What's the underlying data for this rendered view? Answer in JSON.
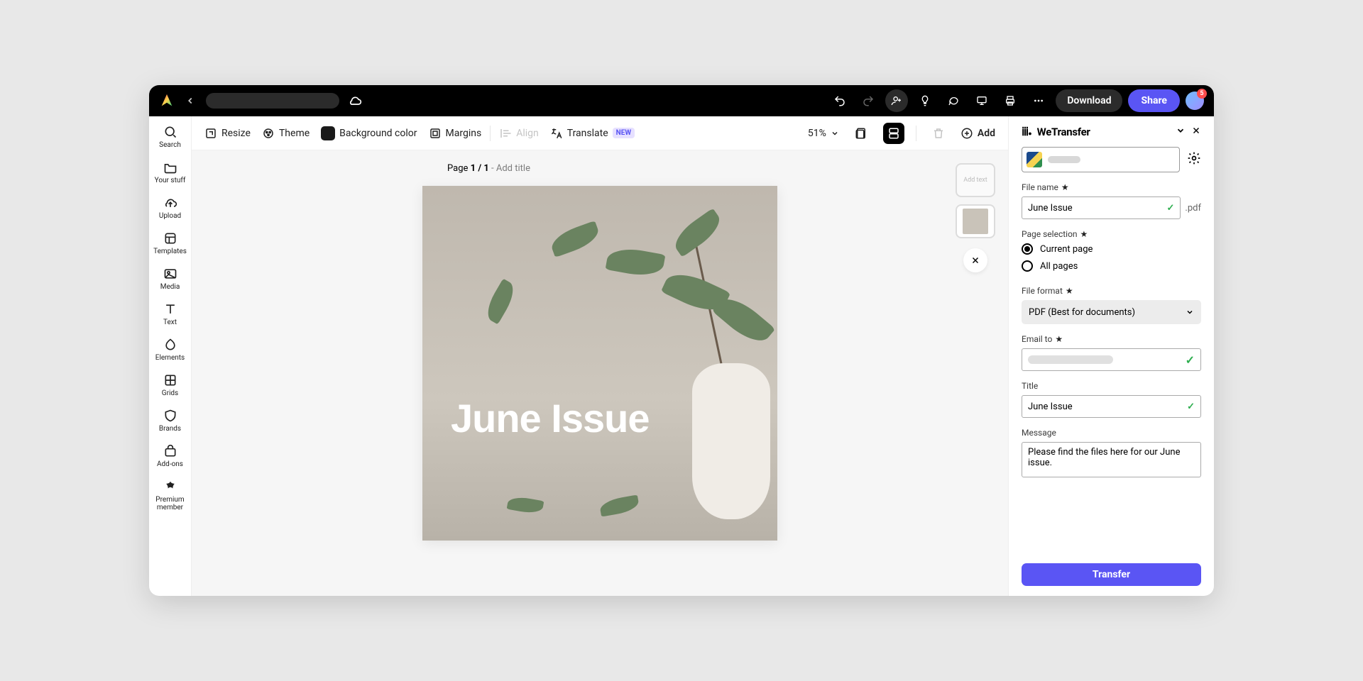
{
  "topbar": {
    "download": "Download",
    "share": "Share",
    "notifications": "5"
  },
  "rail": {
    "search": "Search",
    "your_stuff": "Your stuff",
    "upload": "Upload",
    "templates": "Templates",
    "media": "Media",
    "text": "Text",
    "elements": "Elements",
    "grids": "Grids",
    "brands": "Brands",
    "addons": "Add-ons",
    "premium1": "Premium",
    "premium2": "member"
  },
  "toolbar": {
    "resize": "Resize",
    "theme": "Theme",
    "bg": "Background color",
    "margins": "Margins",
    "align": "Align",
    "translate": "Translate",
    "new": "NEW",
    "zoom": "51%",
    "add": "Add"
  },
  "canvas": {
    "page_prefix": "Page ",
    "page_num": "1 / 1",
    "page_suffix": " - Add title",
    "title_text": "June Issue"
  },
  "panel": {
    "brand": "WeTransfer",
    "filename_label": "File name",
    "filename_value": "June Issue",
    "ext": ".pdf",
    "pagesel_label": "Page selection",
    "opt_current": "Current page",
    "opt_all": "All pages",
    "format_label": "File format",
    "format_value": "PDF (Best for documents)",
    "email_label": "Email to",
    "title_label": "Title",
    "title_value": "June Issue",
    "msg_label": "Message",
    "msg_value": "Please find the files here for our June issue.",
    "transfer": "Transfer"
  }
}
